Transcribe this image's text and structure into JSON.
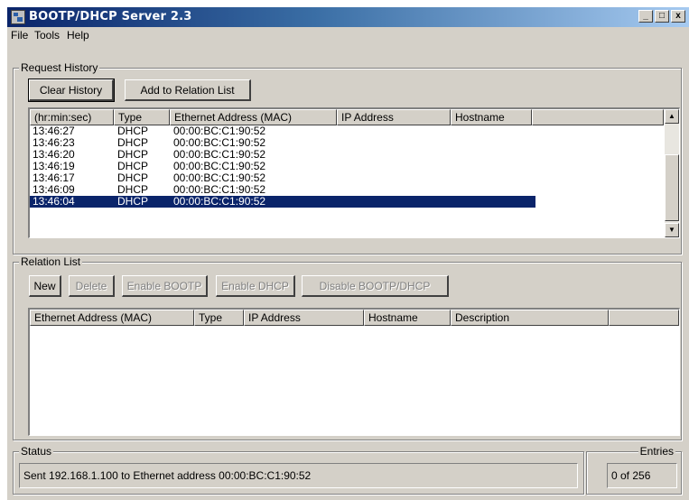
{
  "window": {
    "title": "BOOTP/DHCP Server 2.3",
    "controls": {
      "minimize": "_",
      "maximize": "□",
      "close": "x"
    }
  },
  "menu": {
    "file": "File",
    "tools": "Tools",
    "help": "Help"
  },
  "request_history": {
    "label": "Request History",
    "buttons": {
      "clear_history": "Clear History",
      "add_to_relation": "Add to Relation List"
    },
    "columns": [
      "(hr:min:sec)",
      "Type",
      "Ethernet Address (MAC)",
      "IP Address",
      "Hostname"
    ],
    "rows": [
      {
        "time": "13:46:27",
        "type": "DHCP",
        "mac": "00:00:BC:C1:90:52",
        "ip": "",
        "host": ""
      },
      {
        "time": "13:46:23",
        "type": "DHCP",
        "mac": "00:00:BC:C1:90:52",
        "ip": "",
        "host": ""
      },
      {
        "time": "13:46:20",
        "type": "DHCP",
        "mac": "00:00:BC:C1:90:52",
        "ip": "",
        "host": ""
      },
      {
        "time": "13:46:19",
        "type": "DHCP",
        "mac": "00:00:BC:C1:90:52",
        "ip": "",
        "host": ""
      },
      {
        "time": "13:46:17",
        "type": "DHCP",
        "mac": "00:00:BC:C1:90:52",
        "ip": "",
        "host": ""
      },
      {
        "time": "13:46:09",
        "type": "DHCP",
        "mac": "00:00:BC:C1:90:52",
        "ip": "",
        "host": ""
      },
      {
        "time": "13:46:04",
        "type": "DHCP",
        "mac": "00:00:BC:C1:90:52",
        "ip": "",
        "host": "",
        "selected": true
      }
    ]
  },
  "relation_list": {
    "label": "Relation List",
    "buttons": {
      "new": "New",
      "delete": "Delete",
      "enable_bootp": "Enable BOOTP",
      "enable_dhcp": "Enable DHCP",
      "disable": "Disable BOOTP/DHCP"
    },
    "columns": [
      "Ethernet Address (MAC)",
      "Type",
      "IP Address",
      "Hostname",
      "Description"
    ]
  },
  "status": {
    "label": "Status",
    "text": "Sent 192.168.1.100 to Ethernet address 00:00:BC:C1:90:52"
  },
  "entries": {
    "label": "Entries",
    "value": "0 of 256"
  },
  "colors": {
    "selection": "#0a246a",
    "face": "#d4d0c8",
    "title_start": "#0a246a",
    "title_end": "#a6caf0"
  }
}
